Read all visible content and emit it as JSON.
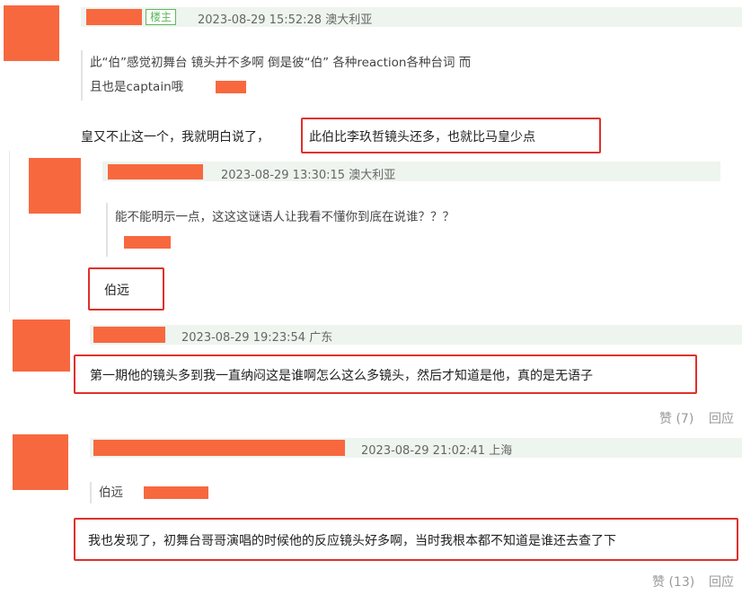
{
  "comments": [
    {
      "badge": "楼主",
      "time": "2023-08-29 15:52:28 澳大利亚",
      "quote_line1": "此“伯”感觉初舞台 镜头并不多啊 倒是彼“伯” 各种reaction各种台词 而",
      "quote_line2": "且也是captain哦",
      "body_plain": "皇又不止这一个，我就明白说了，",
      "body_highlight": "此伯比李玖哲镜头还多，也就比马皇少点"
    },
    {
      "time": "2023-08-29 13:30:15 澳大利亚",
      "quote": "能不能明示一点，这这这谜语人让我看不懂你到底在说谁？？？",
      "body": "伯远"
    },
    {
      "time": "2023-08-29 19:23:54 广东",
      "body": "第一期他的镜头多到我一直纳闷这是谁啊怎么这么多镜头，然后才知道是他，真的是无语子",
      "like_label": "赞 (7)",
      "reply_label": "回应"
    },
    {
      "time": "2023-08-29 21:02:41 上海",
      "quote": "伯远",
      "body": "我也发现了，初舞台哥哥演唱的时候他的反应镜头好多啊，当时我根本都不知道是谁还去查了下",
      "like_label": "赞 (13)",
      "reply_label": "回应"
    }
  ]
}
